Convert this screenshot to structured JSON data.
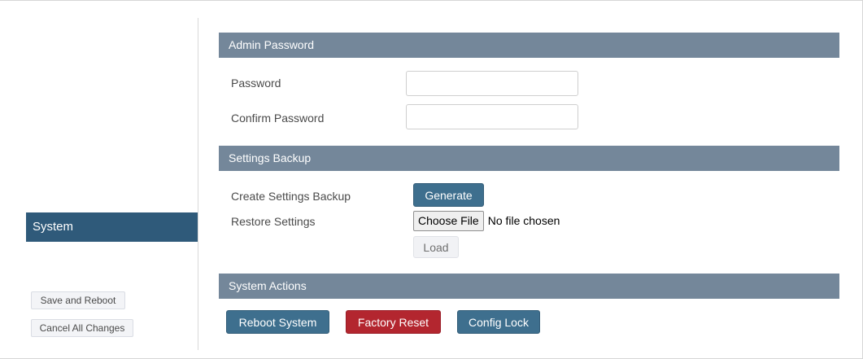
{
  "sidebar": {
    "nav_items": [
      {
        "label": "System",
        "active": true
      }
    ],
    "buttons": {
      "save_reboot": "Save and Reboot",
      "cancel_all": "Cancel All Changes"
    }
  },
  "admin_password": {
    "title": "Admin Password",
    "password_label": "Password",
    "password_value": "",
    "confirm_label": "Confirm Password",
    "confirm_value": ""
  },
  "settings_backup": {
    "title": "Settings Backup",
    "create_label": "Create Settings Backup",
    "generate_button": "Generate",
    "restore_label": "Restore Settings",
    "choose_file_button": "Choose File",
    "file_status": "No file chosen",
    "load_button": "Load"
  },
  "system_actions": {
    "title": "System Actions",
    "reboot_button": "Reboot System",
    "factory_reset_button": "Factory Reset",
    "config_lock_button": "Config Lock"
  },
  "colors": {
    "nav_active_bg": "#2f5a7a",
    "section_header_bg": "#74879a",
    "primary_button": "#3e6f8e",
    "danger_button": "#b3262f"
  }
}
